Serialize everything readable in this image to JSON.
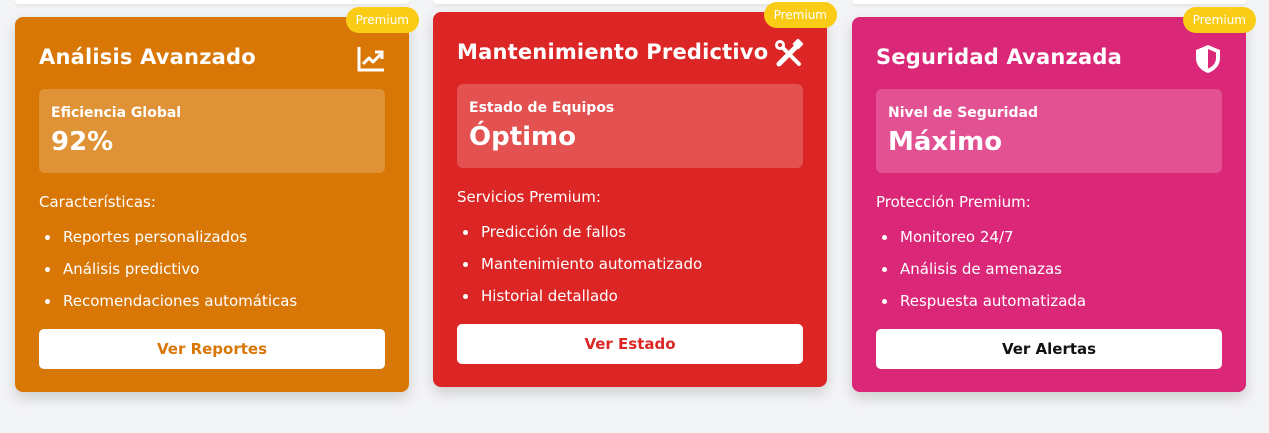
{
  "cards": [
    {
      "badge": "Premium",
      "title": "Análisis Avanzado",
      "icon": "chart-trend-icon",
      "stat_label": "Eficiencia Global",
      "stat_value": "92%",
      "list_title": "Características:",
      "items": [
        "Reportes personalizados",
        "Análisis predictivo",
        "Recomendaciones automáticas"
      ],
      "button": "Ver Reportes",
      "color": "#d97706",
      "button_text_color": "#d97706"
    },
    {
      "badge": "Premium",
      "title": "Mantenimiento Predictivo",
      "icon": "tools-icon",
      "stat_label": "Estado de Equipos",
      "stat_value": "Óptimo",
      "list_title": "Servicios Premium:",
      "items": [
        "Predicción de fallos",
        "Mantenimiento automatizado",
        "Historial detallado"
      ],
      "button": "Ver Estado",
      "color": "#dc2626",
      "button_text_color": "#dc2626"
    },
    {
      "badge": "Premium",
      "title": "Seguridad Avanzada",
      "icon": "shield-icon",
      "stat_label": "Nivel de Seguridad",
      "stat_value": "Máximo",
      "list_title": "Protección Premium:",
      "items": [
        "Monitoreo 24/7",
        "Análisis de amenazas",
        "Respuesta automatizada"
      ],
      "button": "Ver Alertas",
      "color": "#db2777",
      "button_text_color": "#111111"
    }
  ]
}
